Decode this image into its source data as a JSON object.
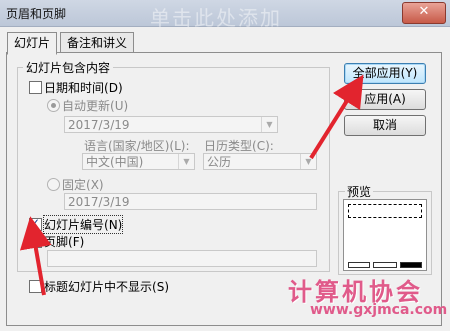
{
  "window": {
    "title": "页眉和页脚",
    "bg_title_text": "单击此处添加",
    "close_label": "✕"
  },
  "tabs": [
    {
      "label": "幻灯片",
      "active": true
    },
    {
      "label": "备注和讲义",
      "active": false
    }
  ],
  "content_group": {
    "legend": "幻灯片包含内容",
    "date_time": {
      "label": "日期和时间",
      "hotkey": "(D)",
      "checked": false
    },
    "auto_update": {
      "label": "自动更新",
      "hotkey": "(U)",
      "selected": true,
      "value": "2017/3/19"
    },
    "language": {
      "label": "语言(国家/地区)",
      "hotkey": "(L):",
      "value": "中文(中国)"
    },
    "calendar": {
      "label": "日历类型",
      "hotkey": "(C):",
      "value": "公历"
    },
    "fixed": {
      "label": "固定",
      "hotkey": "(X)",
      "selected": false,
      "value": "2017/3/19"
    },
    "slide_number": {
      "label": "幻灯片编号",
      "hotkey": "(N)",
      "checked": true
    },
    "footer": {
      "label": "页脚",
      "hotkey": "(F)",
      "checked": false,
      "value": ""
    }
  },
  "hide_on_title": {
    "label": "标题幻灯片中不显示",
    "hotkey": "(S)",
    "checked": false
  },
  "buttons": {
    "apply_all": "全部应用(Y)",
    "apply": "应用(A)",
    "cancel": "取消"
  },
  "preview": {
    "label": "预览"
  },
  "watermark": {
    "text": "计算机协会",
    "url": "www.gxjmca.com"
  },
  "colors": {
    "arrow": "#e2242e",
    "watermark": "#e05a8a",
    "default_button": "#3c7fb1"
  }
}
